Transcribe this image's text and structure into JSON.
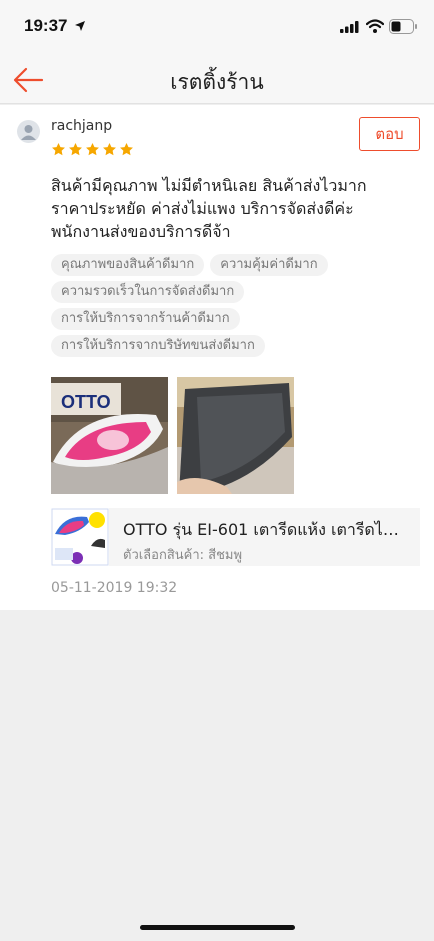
{
  "status_bar": {
    "time": "19:37"
  },
  "header": {
    "title": "เรตติ้งร้าน"
  },
  "review": {
    "username": "rachjanp",
    "rating": 5,
    "max_rating": 5,
    "reply_label": "ตอบ",
    "text": "สินค้ามีคุณภาพ ไม่มีตำหนิเลย สินค้าส่งไวมาก ราคาประหยัด ค่าส่งไม่แพง บริการจัดส่งดีค่ะ พนักงานส่งของบริการดีจ้า",
    "tags": [
      "คุณภาพของสินค้าดีมาก",
      "ความคุ้มค่าดีมาก",
      "ความรวดเร็วในการจัดส่งดีมาก",
      "การให้บริการจากร้านค้าดีมาก",
      "การให้บริการจากบริษัทขนส่งดีมาก"
    ],
    "product": {
      "name": "OTTO รุ่น EI-601 เตารีดแห้ง เตารีดไฟ...",
      "variant": "ตัวเลือกสินค้า: สีชมพู"
    },
    "date": "05-11-2019 19:32"
  },
  "colors": {
    "accent": "#ee4d2d",
    "star": "#f6a700"
  }
}
